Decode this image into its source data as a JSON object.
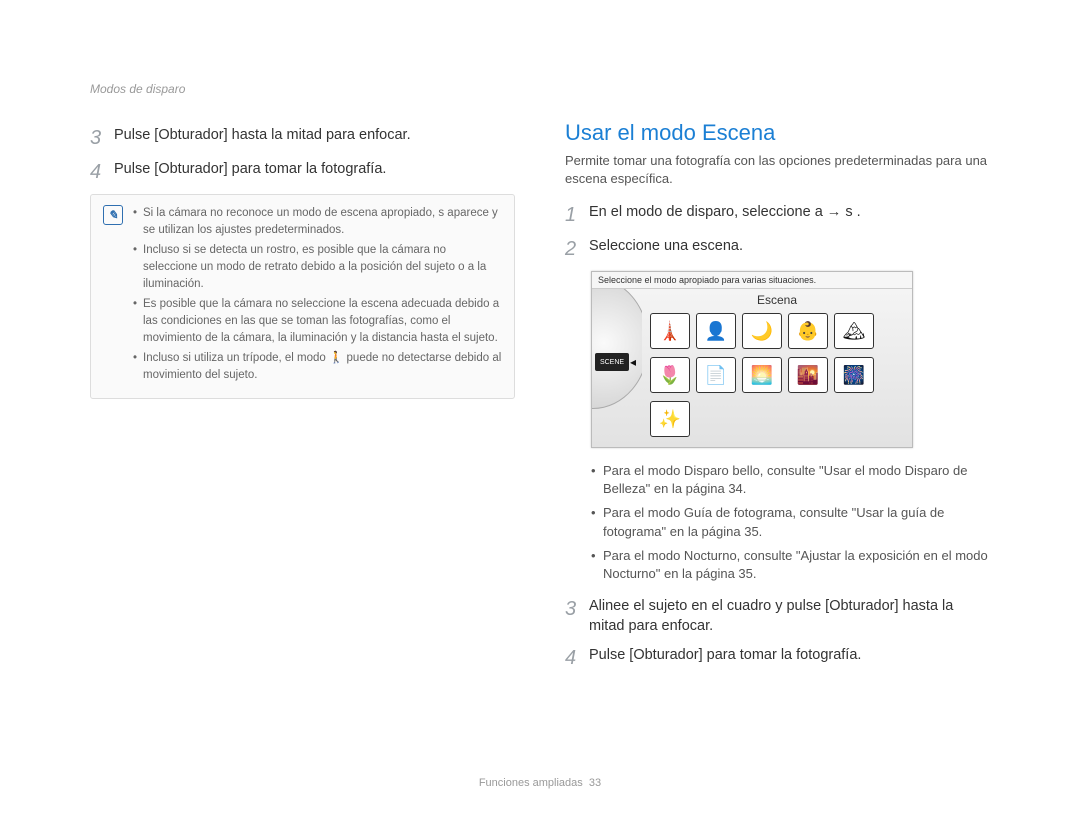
{
  "breadcrumb": "Modos de disparo",
  "left": {
    "steps": [
      {
        "num": "3",
        "text": "Pulse [Obturador] hasta la mitad para enfocar."
      },
      {
        "num": "4",
        "text": "Pulse [Obturador] para tomar la fotografía."
      }
    ],
    "note": {
      "items": [
        "Si la cámara no reconoce un modo de escena apropiado, s aparece y se utilizan los ajustes predeterminados.",
        "Incluso si se detecta un rostro, es posible que la cámara no seleccione un modo de retrato debido a la posición del sujeto o a la iluminación.",
        "Es posible que la cámara no seleccione la escena adecuada debido a las condiciones en las que se toman las fotografías, como el movimiento de la cámara, la iluminación y la distancia hasta el sujeto.",
        "Incluso si utiliza un trípode, el modo 🚶 puede no detectarse debido al movimiento del sujeto."
      ]
    }
  },
  "right": {
    "title": "Usar el modo Escena",
    "intro": "Permite tomar una fotografía con las opciones predeterminadas para una escena específica.",
    "steps_a": [
      {
        "num": "1",
        "text": "En el modo de disparo, seleccione a → s ."
      },
      {
        "num": "2",
        "text": "Seleccione una escena."
      }
    ],
    "screen": {
      "hint": "Seleccione el modo apropiado para varias situaciones.",
      "title": "Escena",
      "dial_label": "SCENE",
      "icons": [
        "🗼",
        "👤",
        "🌙",
        "👶",
        "🏔",
        "🌷",
        "📄",
        "🌅",
        "🌇",
        "🎆",
        "✨"
      ]
    },
    "refs": [
      "Para el modo Disparo bello, consulte \"Usar el modo Disparo de Belleza\" en la página 34.",
      "Para el modo Guía de fotograma, consulte \"Usar la guía de fotograma\" en la página 35.",
      "Para el modo Nocturno, consulte \"Ajustar la exposición en el modo Nocturno\" en la página 35."
    ],
    "steps_b": [
      {
        "num": "3",
        "text": "Alinee el sujeto en el cuadro y pulse [Obturador] hasta la mitad para enfocar."
      },
      {
        "num": "4",
        "text": "Pulse [Obturador] para tomar la fotografía."
      }
    ]
  },
  "footer": {
    "section": "Funciones ampliadas",
    "page": "33"
  }
}
